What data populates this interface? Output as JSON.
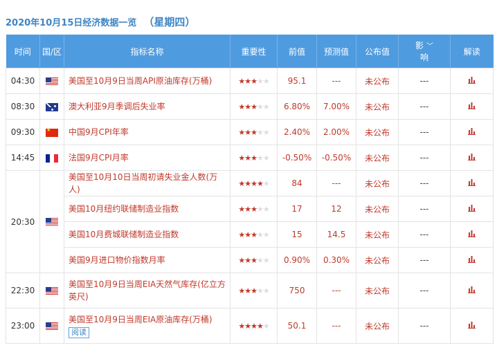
{
  "header": {
    "date_title": "2020年10月15日经济数据一览",
    "weekday": "（星期四）"
  },
  "columns": {
    "time": "时间",
    "region": "国/区",
    "indicator": "指标名称",
    "importance": "重要性",
    "previous": "前值",
    "forecast": "预测值",
    "actual": "公布值",
    "impact_top": "影",
    "impact_bottom": "响",
    "interpret": "解读"
  },
  "groups": [
    {
      "time": "04:30",
      "flag": "us",
      "rows": [
        {
          "name": "美国至10月9日当周API原油库存(万桶)",
          "stars": 3,
          "previous": "95.1",
          "forecast": "---",
          "actual": "未公布",
          "impact": "---"
        }
      ]
    },
    {
      "time": "08:30",
      "flag": "au",
      "rows": [
        {
          "name": "澳大利亚9月季调后失业率",
          "stars": 3,
          "previous": "6.80%",
          "forecast": "7.00%",
          "actual": "未公布",
          "impact": "---"
        }
      ]
    },
    {
      "time": "09:30",
      "flag": "cn",
      "rows": [
        {
          "name": "中国9月CPI年率",
          "stars": 3,
          "previous": "2.40%",
          "forecast": "2.00%",
          "actual": "未公布",
          "impact": "---"
        }
      ]
    },
    {
      "time": "14:45",
      "flag": "fr",
      "rows": [
        {
          "name": "法国9月CPI月率",
          "stars": 3,
          "previous": "-0.50%",
          "forecast": "-0.50%",
          "actual": "未公布",
          "impact": "---"
        }
      ]
    },
    {
      "time": "20:30",
      "flag": "us",
      "rows": [
        {
          "name": "美国至10月10日当周初请失业金人数(万人)",
          "stars": 4,
          "previous": "84",
          "forecast": "---",
          "actual": "未公布",
          "impact": "---"
        },
        {
          "name": "美国10月纽约联储制造业指数",
          "stars": 3,
          "previous": "17",
          "forecast": "12",
          "actual": "未公布",
          "impact": "---"
        },
        {
          "name": "美国10月费城联储制造业指数",
          "stars": 3,
          "previous": "15",
          "forecast": "14.5",
          "actual": "未公布",
          "impact": "---"
        },
        {
          "name": "美国9月进口物价指数月率",
          "stars": 3,
          "previous": "0.90%",
          "forecast": "0.30%",
          "actual": "未公布",
          "impact": "---"
        }
      ]
    },
    {
      "time": "22:30",
      "flag": "us",
      "rows": [
        {
          "name": "美国至10月9日当周EIA天然气库存(亿立方英尺)",
          "stars": 3,
          "previous": "750",
          "forecast": "---",
          "actual": "未公布",
          "impact": "---"
        }
      ]
    },
    {
      "time": "23:00",
      "flag": "us",
      "rows": [
        {
          "name": "美国至10月9日当周EIA原油库存(万桶)",
          "stars": 4,
          "previous": "50.1",
          "forecast": "---",
          "actual": "未公布",
          "impact": "---",
          "read_label": "阅读"
        }
      ]
    }
  ],
  "icons": {
    "chart": "bar-chart-icon",
    "chevron": "chevron-down-icon"
  },
  "colors": {
    "header_bg": "#4f9be0",
    "accent_red": "#c0392b",
    "title_blue": "#3d85c6"
  }
}
